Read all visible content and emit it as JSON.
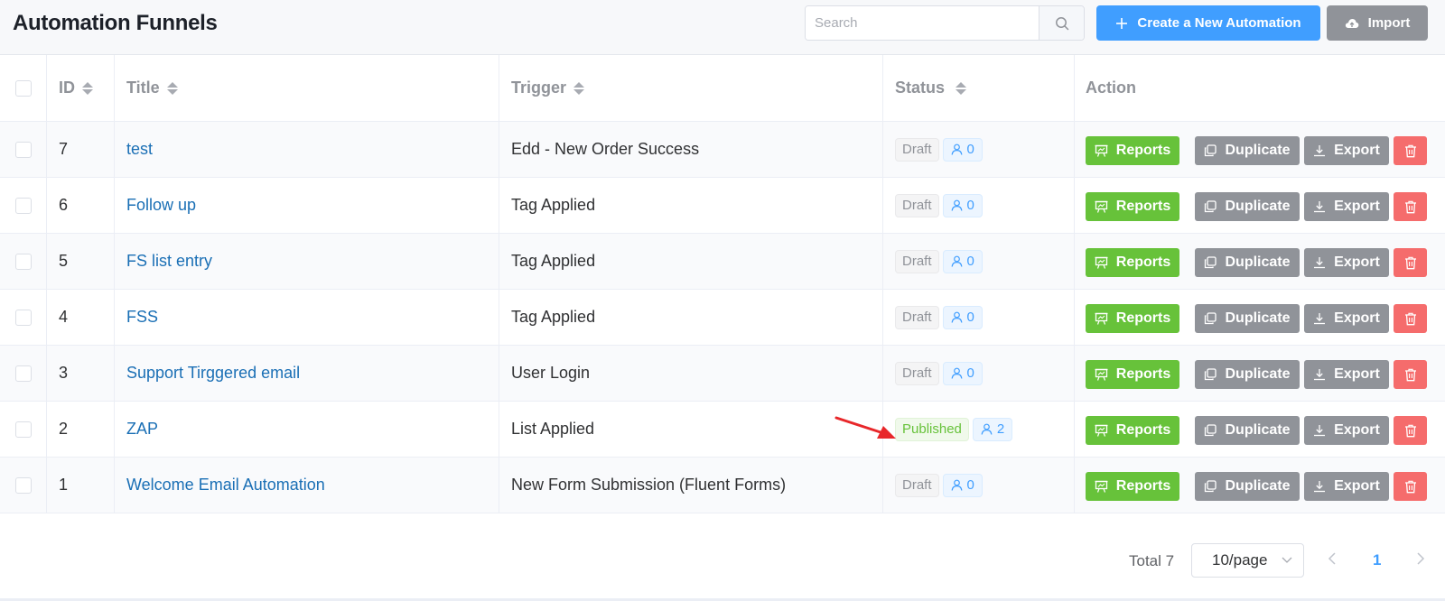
{
  "header": {
    "title": "Automation Funnels",
    "search_placeholder": "Search",
    "create_label": "Create a New Automation",
    "import_label": "Import"
  },
  "columns": {
    "id": "ID",
    "title": "Title",
    "trigger": "Trigger",
    "status": "Status",
    "action": "Action"
  },
  "actions": {
    "reports": "Reports",
    "duplicate": "Duplicate",
    "export": "Export"
  },
  "rows": [
    {
      "id": "7",
      "title": "test",
      "trigger": "Edd - New Order Success",
      "status": "Draft",
      "count": "0"
    },
    {
      "id": "6",
      "title": "Follow up",
      "trigger": "Tag Applied",
      "status": "Draft",
      "count": "0"
    },
    {
      "id": "5",
      "title": "FS list entry",
      "trigger": "Tag Applied",
      "status": "Draft",
      "count": "0"
    },
    {
      "id": "4",
      "title": "FSS",
      "trigger": "Tag Applied",
      "status": "Draft",
      "count": "0"
    },
    {
      "id": "3",
      "title": "Support Tirggered email",
      "trigger": "User Login",
      "status": "Draft",
      "count": "0"
    },
    {
      "id": "2",
      "title": "ZAP",
      "trigger": "List Applied",
      "status": "Published",
      "count": "2"
    },
    {
      "id": "1",
      "title": "Welcome Email Automation",
      "trigger": "New Form Submission (Fluent Forms)",
      "status": "Draft",
      "count": "0"
    }
  ],
  "pagination": {
    "total": "Total 7",
    "page_size": "10/page",
    "current_page": "1"
  },
  "colors": {
    "primary": "#409eff",
    "success": "#67c23a",
    "info": "#909399",
    "danger": "#f56c6c",
    "link": "#1a6fb5",
    "annotation_arrow": "#e8272a"
  }
}
